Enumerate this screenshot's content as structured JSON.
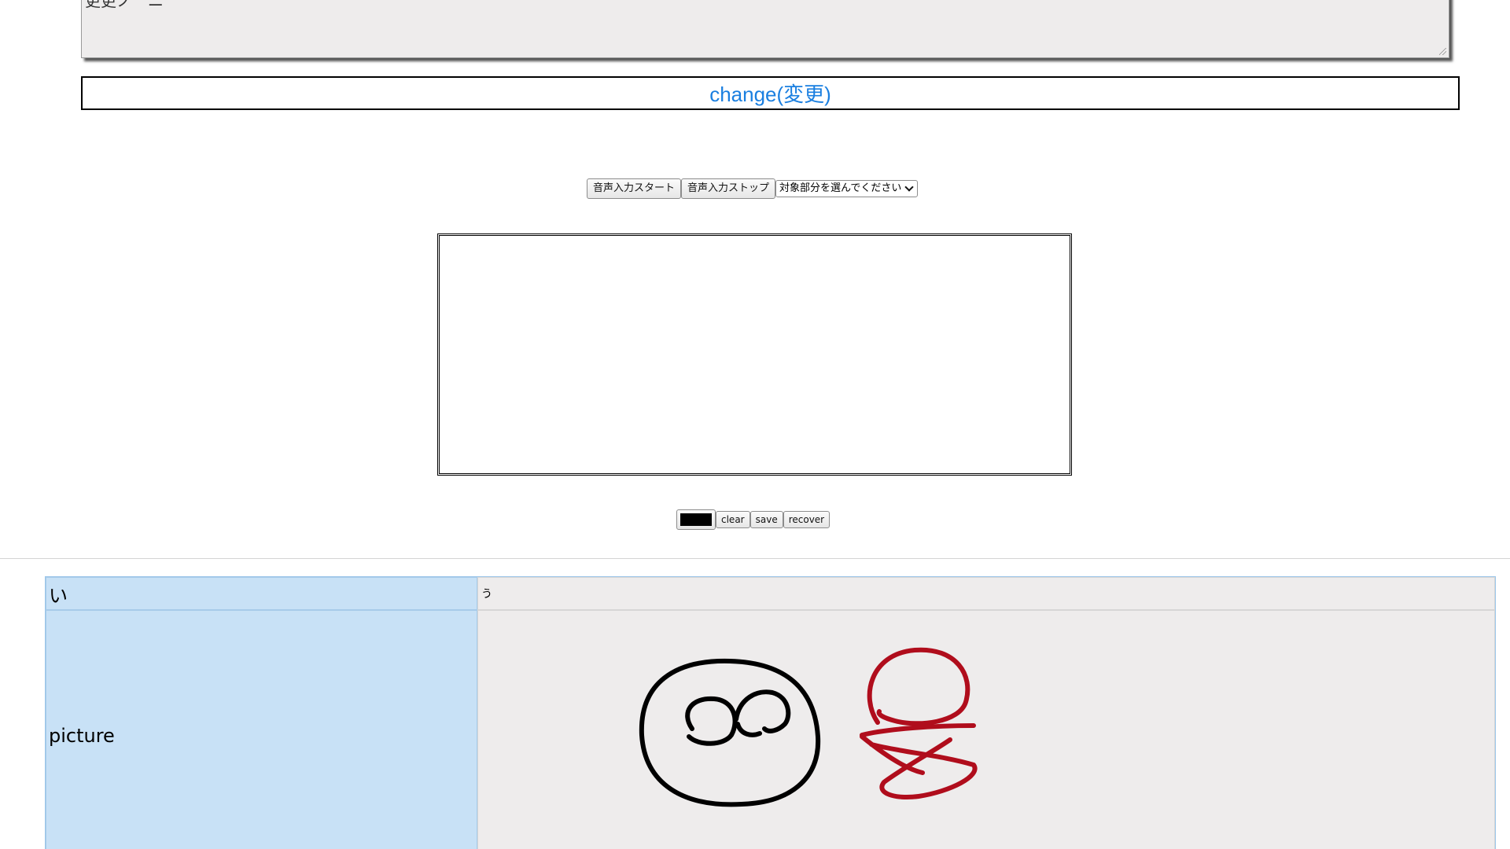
{
  "editor": {
    "text_value": "更更ノ　ニ"
  },
  "change_button": {
    "label": "change(変更)"
  },
  "voice": {
    "start_label": "音声入力スタート",
    "stop_label": "音声入力ストップ",
    "target_select": "対象部分を選んでください"
  },
  "drawing": {
    "pen_color": "#000000",
    "clear_label": "clear",
    "save_label": "save",
    "recover_label": "recover"
  },
  "table": {
    "rows": [
      {
        "header": "い",
        "value": "う"
      },
      {
        "header": "picture",
        "value": ""
      }
    ],
    "picture_stroke_colors": [
      "#000000",
      "#b00d1c"
    ]
  }
}
